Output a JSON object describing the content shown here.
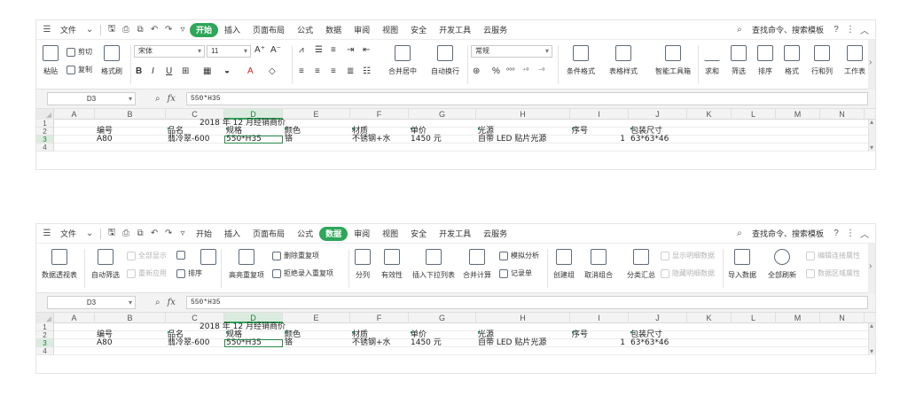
{
  "menu": {
    "file": "文件",
    "tabs": [
      "插入",
      "页面布局",
      "公式",
      "数据",
      "审阅",
      "视图",
      "安全",
      "开发工具",
      "云服务"
    ],
    "start": "开始",
    "search": "查找命令、搜索模板",
    "help": "?"
  },
  "home_ribbon": {
    "paste": "粘贴",
    "cut": "剪切",
    "copy": "复制",
    "format_painter": "格式刷",
    "font_name": "宋体",
    "font_size": "11",
    "merge_center": "合并居中",
    "wrap_text": "自动换行",
    "number_format": "常规",
    "cond_format": "条件格式",
    "table_style": "表格样式",
    "smart_toolbox": "智能工具箱",
    "sum": "求和",
    "filter": "筛选",
    "sort": "排序",
    "format": "格式",
    "row_col": "行和列",
    "worksheet": "工作表"
  },
  "data_ribbon": {
    "pivot": "数据透视表",
    "auto_filter": "自动筛选",
    "show_all": "全部显示",
    "reapply": "重新应用",
    "sort": "排序",
    "highlight_dup": "高亮重复项",
    "remove_dup": "删除重复项",
    "reject_dup": "拒绝录入重复项",
    "split": "分列",
    "validity": "有效性",
    "dropdown": "插入下拉列表",
    "consolidate": "合并计算",
    "simulate": "模拟分析",
    "record": "记录单",
    "group": "创建组",
    "ungroup": "取消组合",
    "subtotal": "分类汇总",
    "show_detail": "显示明细数据",
    "hide_detail": "隐藏明细数据",
    "import": "导入数据",
    "refresh_all": "全部刷新",
    "edit_links": "编辑连接属性",
    "data_area": "数据区域属性"
  },
  "formula_bar": {
    "cell_ref": "D3",
    "fx": "fx",
    "value": "550*H35"
  },
  "sheet": {
    "columns": [
      "A",
      "B",
      "C",
      "D",
      "E",
      "F",
      "G",
      "H",
      "I",
      "J",
      "K",
      "L",
      "M",
      "N"
    ],
    "rows": [
      "1",
      "2",
      "3",
      "4"
    ],
    "title": "2018 年 12 月经销商价",
    "headers": [
      "编号",
      "品名",
      "规格",
      "颜色",
      "材质",
      "单价",
      "光源",
      "序号",
      "包装尺寸"
    ],
    "record": [
      "A80",
      "翡冷翠-600",
      "550*H35",
      "铬",
      "不锈钢+水",
      "1450 元",
      "自带 LED 贴片光源",
      "1",
      "63*63*46"
    ]
  }
}
